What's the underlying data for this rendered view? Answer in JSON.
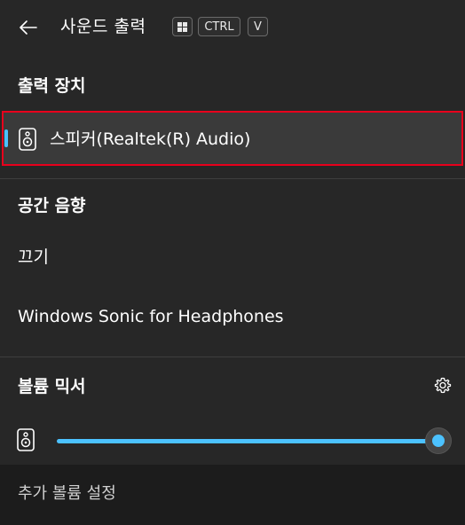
{
  "header": {
    "title": "사운드 출력",
    "shortcut_keys": [
      "",
      "CTRL",
      "V"
    ]
  },
  "output_devices": {
    "section_title": "출력 장치",
    "items": [
      {
        "label": "스피커(Realtek(R) Audio)",
        "selected": true
      }
    ]
  },
  "spatial_sound": {
    "section_title": "공간 음향",
    "options": [
      {
        "label": "끄기"
      },
      {
        "label": "Windows Sonic for Headphones"
      }
    ]
  },
  "volume_mixer": {
    "section_title": "볼륨 믹서",
    "volume_level": 1.0
  },
  "footer": {
    "link": "추가 볼륨 설정"
  },
  "colors": {
    "accent": "#4cc2ff",
    "focus_outline": "#e8001c",
    "background": "#272727",
    "footer_background": "#1c1c1c"
  },
  "icons": [
    "back-arrow-icon",
    "windows-key-icon",
    "speaker-icon",
    "gear-icon"
  ]
}
